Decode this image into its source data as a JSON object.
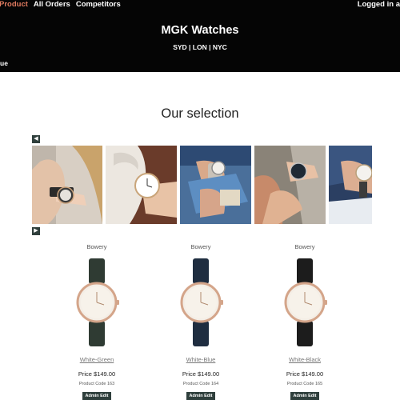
{
  "nav": {
    "product": "Product",
    "all_orders": "All Orders",
    "competitors": "Competitors",
    "logged_in": "Logged in a",
    "sub_link": "ue"
  },
  "header": {
    "brand": "MGK Watches",
    "cities": "SYD | LON | NYC"
  },
  "section": {
    "title": "Our selection"
  },
  "carousel": {
    "prev": "◀",
    "next": "▶"
  },
  "products": [
    {
      "brand": "Bowery",
      "name": "White-Green",
      "price": "Price $149.00",
      "code": "Product Code 163",
      "admin": "Admin Edit",
      "strap_color": "#2f3b33"
    },
    {
      "brand": "Bowery",
      "name": "White-Blue",
      "price": "Price $149.00",
      "code": "Product Code 164",
      "admin": "Admin Edit",
      "strap_color": "#1f2d40"
    },
    {
      "brand": "Bowery",
      "name": "White-Black",
      "price": "Price $149.00",
      "code": "Product Code 165",
      "admin": "Admin Edit",
      "strap_color": "#1c1c1c"
    }
  ],
  "colors": {
    "header_bg": "#050505",
    "active_nav": "#e07a5f",
    "button_bg": "#2f3f3c"
  }
}
